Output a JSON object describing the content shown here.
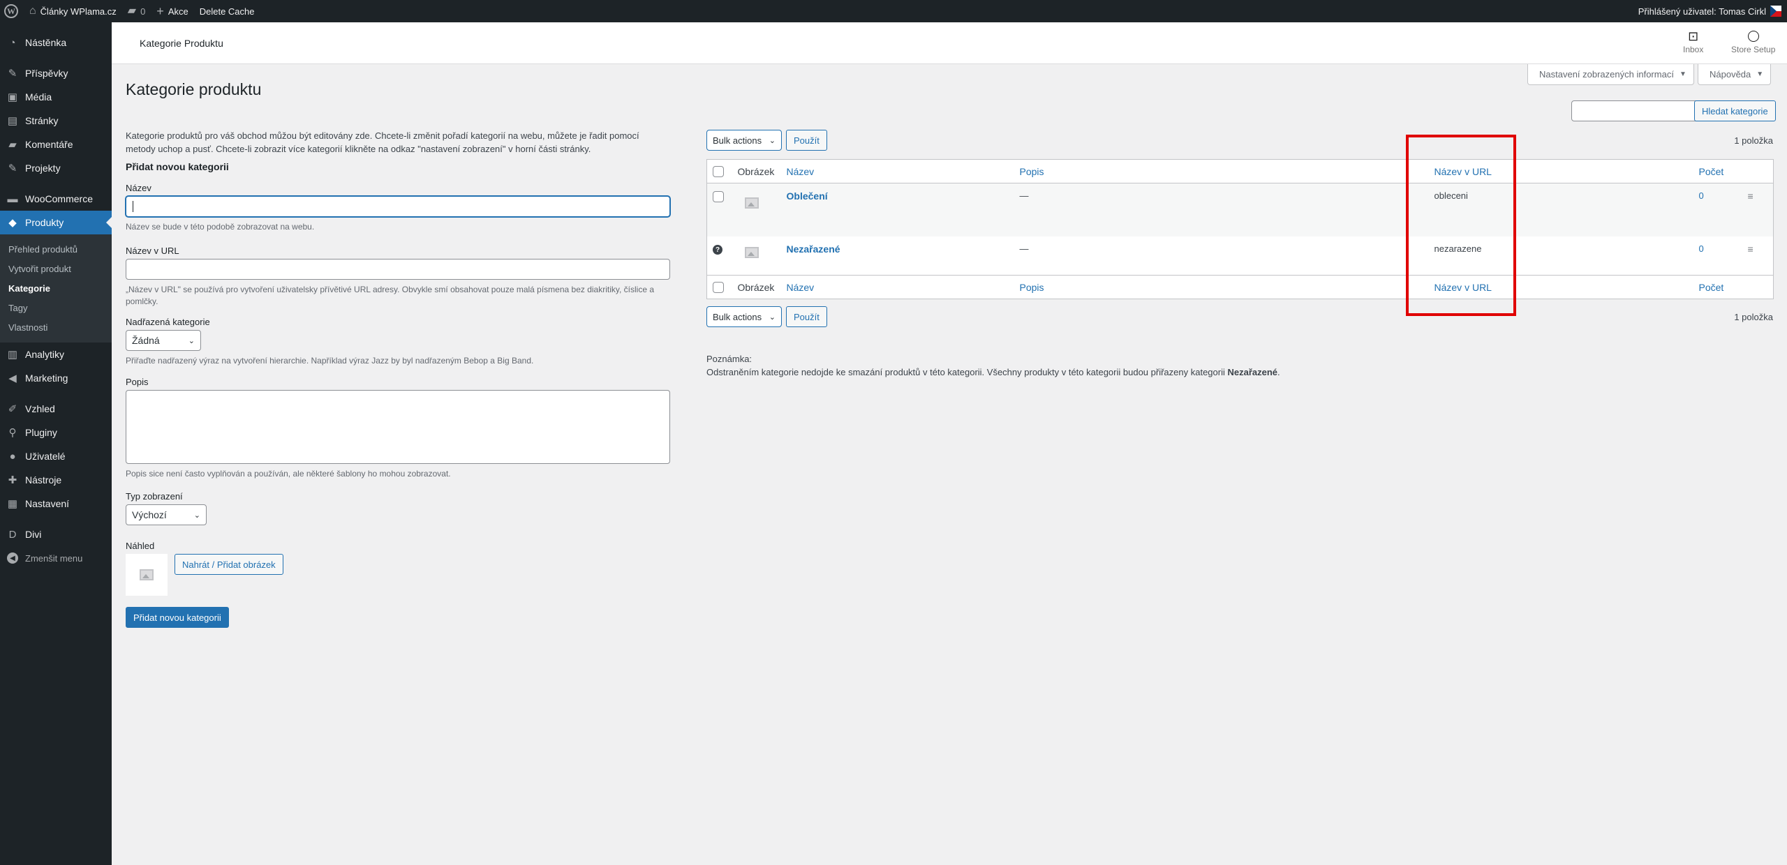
{
  "admin_bar": {
    "site_name": "Články WPlama.cz",
    "comments_count": "0",
    "new_label": "Akce",
    "delete_cache": "Delete Cache",
    "user_greeting": "Přihlášený uživatel: Tomas Cirkl"
  },
  "sidebar": {
    "items": [
      {
        "label": "Nástěnka",
        "icon": "dashboard-icon"
      },
      {
        "label": "Příspěvky",
        "icon": "pin-icon"
      },
      {
        "label": "Média",
        "icon": "media-icon"
      },
      {
        "label": "Stránky",
        "icon": "page-icon"
      },
      {
        "label": "Komentáře",
        "icon": "comment-icon"
      },
      {
        "label": "Projekty",
        "icon": "portfolio-icon"
      },
      {
        "label": "WooCommerce",
        "icon": "woo-icon"
      },
      {
        "label": "Produkty",
        "icon": "product-icon"
      },
      {
        "label": "Analytiky",
        "icon": "chart-icon"
      },
      {
        "label": "Marketing",
        "icon": "megaphone-icon"
      },
      {
        "label": "Vzhled",
        "icon": "brush-icon"
      },
      {
        "label": "Pluginy",
        "icon": "plugin-icon"
      },
      {
        "label": "Uživatelé",
        "icon": "user-icon"
      },
      {
        "label": "Nástroje",
        "icon": "wrench-icon"
      },
      {
        "label": "Nastavení",
        "icon": "settings-icon"
      },
      {
        "label": "Divi",
        "icon": "divi-icon"
      }
    ],
    "submenu": [
      "Přehled produktů",
      "Vytvořit produkt",
      "Kategorie",
      "Tagy",
      "Vlastnosti"
    ],
    "collapse": "Zmenšit menu"
  },
  "header": {
    "title": "Kategorie Produktu",
    "inbox": "Inbox",
    "store_setup": "Store Setup",
    "screen_options": "Nastavení zobrazených informací",
    "help": "Nápověda"
  },
  "page_title": "Kategorie produktu",
  "form": {
    "intro": "Kategorie produktů pro váš obchod můžou být editovány zde. Chcete-li změnit pořadí kategorií na webu, můžete je řadit pomocí metody uchop a pusť. Chcete-li zobrazit více kategorií klikněte na odkaz \"nastavení zobrazení\" v horní části stránky.",
    "heading": "Přidat novou kategorii",
    "name_label": "Název",
    "name_help": "Název se bude v této podobě zobrazovat na webu.",
    "slug_label": "Název v URL",
    "slug_help": "„Název v URL\" se používá pro vytvoření uživatelsky přívětivé URL adresy. Obvykle smí obsahovat pouze malá písmena bez diakritiky, číslice a pomlčky.",
    "parent_label": "Nadřazená kategorie",
    "parent_value": "Žádná",
    "parent_help": "Přiřaďte nadřazený výraz na vytvoření hierarchie. Například výraz Jazz by byl nadřazeným Bebop a Big Band.",
    "desc_label": "Popis",
    "desc_help": "Popis sice není často vyplňován a používán, ale některé šablony ho mohou zobrazovat.",
    "display_label": "Typ zobrazení",
    "display_value": "Výchozí",
    "thumb_label": "Náhled",
    "upload_btn": "Nahrát / Přidat obrázek",
    "submit_btn": "Přidat novou kategorii"
  },
  "list": {
    "search_btn": "Hledat kategorie",
    "bulk_label": "Bulk actions",
    "apply_label": "Použít",
    "count": "1 položka",
    "columns": {
      "image": "Obrázek",
      "name": "Název",
      "desc": "Popis",
      "slug": "Název v URL",
      "count": "Počet"
    },
    "rows": [
      {
        "name": "Oblečení",
        "desc": "—",
        "slug": "obleceni",
        "count": "0"
      },
      {
        "name": "Nezařazené",
        "desc": "—",
        "slug": "nezarazene",
        "count": "0"
      }
    ],
    "note_title": "Poznámka:",
    "note_text": "Odstraněním kategorie nedojde ke smazání produktů v této kategorii. Všechny produkty v této kategorii budou přiřazeny kategorii ",
    "note_bold": "Nezařazené",
    "note_end": "."
  }
}
